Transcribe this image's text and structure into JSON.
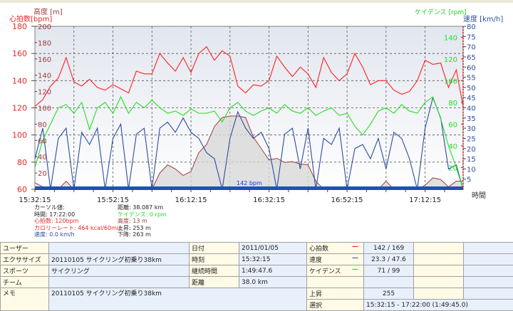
{
  "chart_data": {
    "type": "line",
    "x_axis": {
      "label": "時間",
      "start": "15:32:15",
      "end": "17:22:00",
      "tick_labels": [
        "15:32:15",
        "15:52:15",
        "16:12:15",
        "16:32:15",
        "16:52:15",
        "17:12:15"
      ]
    },
    "axes": {
      "heart_rate": {
        "label": "心拍数[bpm]",
        "range": [
          60,
          180
        ],
        "ticks": [
          60,
          80,
          100,
          120,
          140,
          160,
          180
        ],
        "color": "#e82828",
        "side": "left"
      },
      "altitude": {
        "label": "高度 [m]",
        "range": [
          0,
          200
        ],
        "ticks": [
          20,
          40,
          60,
          80,
          100,
          120,
          140,
          160,
          180,
          200
        ],
        "color": "#a03c3c",
        "side": "left-inner"
      },
      "cadence": {
        "label": "ケイデンス [rpm]",
        "range": [
          0,
          150
        ],
        "ticks": [
          20,
          40,
          60,
          80,
          100,
          120,
          140
        ],
        "color": "#22e022",
        "side": "right-inner"
      },
      "speed": {
        "label": "速度 [km/h]",
        "range": [
          0,
          80
        ],
        "ticks": [
          5,
          10,
          15,
          20,
          25,
          30,
          35,
          40,
          45,
          50,
          55,
          60,
          65,
          70,
          75,
          80
        ],
        "color": "#2c4ca0",
        "side": "right"
      }
    },
    "grid": true,
    "x": [
      "15:32:15",
      "15:34:15",
      "15:36:15",
      "15:38:15",
      "15:40:15",
      "15:42:15",
      "15:44:15",
      "15:46:15",
      "15:48:15",
      "15:50:15",
      "15:52:15",
      "15:54:15",
      "15:56:15",
      "15:58:15",
      "16:00:15",
      "16:02:15",
      "16:04:15",
      "16:06:15",
      "16:08:15",
      "16:10:15",
      "16:12:15",
      "16:14:15",
      "16:16:15",
      "16:18:15",
      "16:20:15",
      "16:22:15",
      "16:24:15",
      "16:26:15",
      "16:28:15",
      "16:30:15",
      "16:32:15",
      "16:34:15",
      "16:36:15",
      "16:38:15",
      "16:40:15",
      "16:42:15",
      "16:44:15",
      "16:46:15",
      "16:48:15",
      "16:50:15",
      "16:52:15",
      "16:54:15",
      "16:56:15",
      "16:58:15",
      "17:00:15",
      "17:02:15",
      "17:04:15",
      "17:06:15",
      "17:08:15",
      "17:10:15",
      "17:12:15",
      "17:14:15",
      "17:16:15",
      "17:18:15",
      "17:20:15",
      "17:22:00"
    ],
    "series": [
      {
        "key": "altitude",
        "values": [
          8,
          3,
          0,
          0,
          10,
          0,
          0,
          0,
          0,
          0,
          0,
          0,
          0,
          0,
          0,
          0,
          20,
          30,
          25,
          17,
          22,
          45,
          55,
          77,
          88,
          90,
          90,
          88,
          64,
          50,
          36,
          38,
          33,
          34,
          31,
          30,
          10,
          0,
          0,
          0,
          0,
          0,
          0,
          0,
          0,
          10,
          0,
          0,
          0,
          0,
          5,
          14,
          12,
          3,
          10,
          10
        ]
      },
      {
        "key": "speed",
        "values": [
          15,
          30,
          0,
          25,
          30,
          0,
          28,
          22,
          30,
          0,
          25,
          32,
          0,
          27,
          30,
          0,
          30,
          33,
          28,
          35,
          28,
          25,
          18,
          15,
          0,
          25,
          38,
          30,
          25,
          28,
          20,
          0,
          27,
          30,
          10,
          30,
          0,
          25,
          22,
          30,
          0,
          20,
          22,
          15,
          25,
          10,
          28,
          25,
          15,
          0,
          30,
          45,
          35,
          10,
          12,
          0
        ]
      },
      {
        "key": "cadence",
        "values": [
          20,
          45,
          60,
          75,
          78,
          70,
          80,
          55,
          75,
          80,
          70,
          85,
          70,
          80,
          75,
          82,
          75,
          70,
          72,
          68,
          74,
          70,
          70,
          72,
          62,
          75,
          80,
          72,
          68,
          72,
          75,
          70,
          78,
          72,
          70,
          75,
          68,
          72,
          75,
          68,
          70,
          58,
          50,
          60,
          72,
          75,
          70,
          78,
          72,
          70,
          80,
          85,
          65,
          40,
          20,
          0
        ]
      },
      {
        "key": "heart_rate",
        "values": [
          121,
          126,
          136,
          142,
          157,
          139,
          136,
          141,
          135,
          133,
          137,
          134,
          131,
          147,
          145,
          145,
          160,
          153,
          147,
          157,
          146,
          160,
          165,
          155,
          162,
          158,
          136,
          131,
          137,
          136,
          140,
          158,
          150,
          143,
          150,
          145,
          135,
          157,
          146,
          140,
          145,
          160,
          150,
          137,
          140,
          140,
          133,
          130,
          132,
          140,
          155,
          152,
          153,
          135,
          148,
          121
        ]
      }
    ],
    "annotation": "142 bpm"
  },
  "cursor": {
    "title": "カーソル値:",
    "time": "時間: 17:22:00",
    "heart_rate": "心拍数: 120bpm",
    "calorie_rate": "カロリーレート: 464 kcal/60min",
    "speed": "速度: 0.0 km/h",
    "distance": "距離: 38.087 km",
    "cadence": "ケイデンス: 0 rpm",
    "altitude": "高度: 13 m",
    "ascent": "上昇: 253 m",
    "descent": "下降: 263 m"
  },
  "table": {
    "user_label": "ユーザー",
    "user": "",
    "exercise_label": "エクササイズ",
    "exercise": "20110105 サイクリング初乗り38km",
    "sport_label": "スポーツ",
    "sport": "サイクリング",
    "team_label": "チーム",
    "team": "",
    "memo_label": "メモ",
    "memo": "20110105 サイクリング初乗り38km",
    "date_label": "日付",
    "date": "2011/01/05",
    "time_label": "時刻",
    "time": "15:32:15",
    "duration_label": "継続時間",
    "duration": "1:49:47.6",
    "distance_label": "距離",
    "distance": "38.0 km",
    "hr_label": "心拍数",
    "hr": "142 / 169",
    "hr_color": "#ff2020",
    "speed_label": "速度",
    "speed": "23.3 / 47.6",
    "speed_color": "#4060b0",
    "cadence_label": "ケイデンス",
    "cadence": "71 / 99",
    "cadence_color": "#20e020",
    "ascent_label": "上昇",
    "ascent": "255",
    "selection_label": "選択",
    "selection": "15:32:15 - 17:22:00 (1:49:45.0)"
  }
}
